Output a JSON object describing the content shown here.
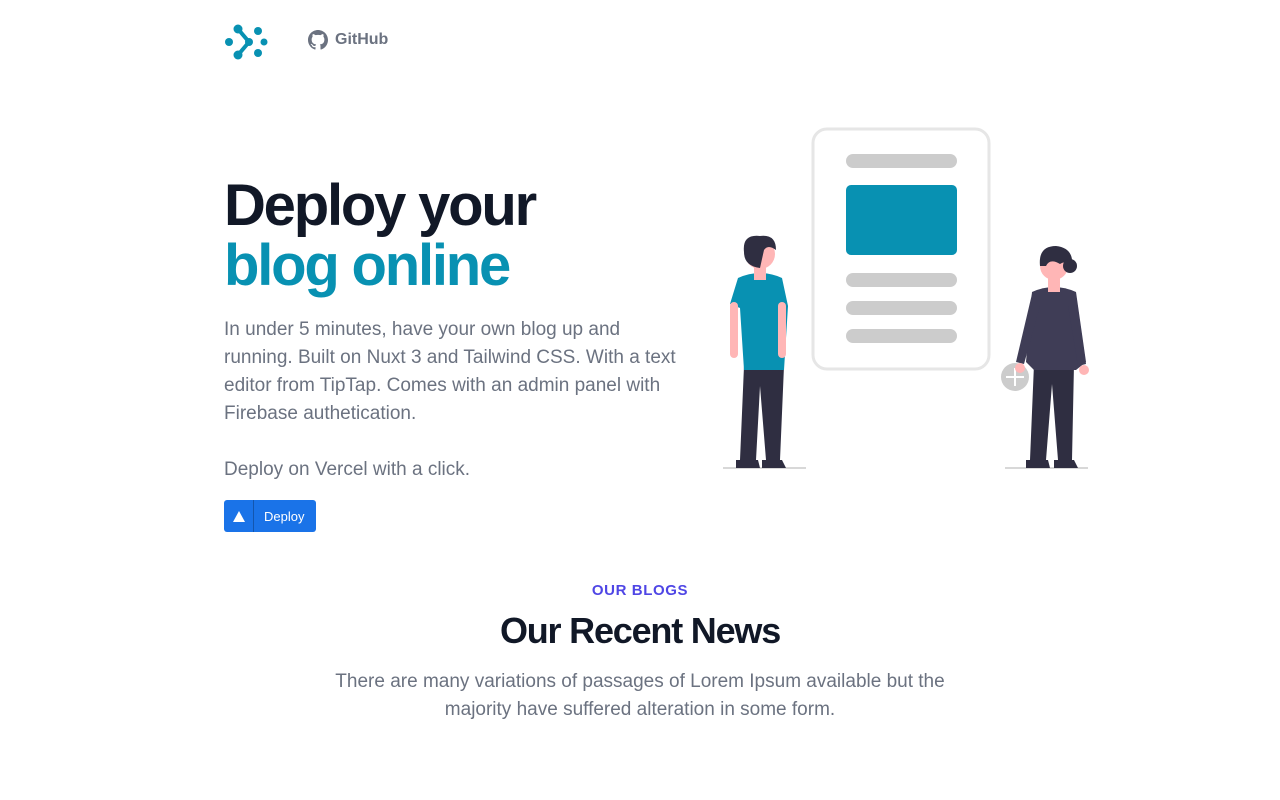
{
  "nav": {
    "logo_icon": "dots-chevron-logo-icon",
    "github_icon": "github-icon",
    "github_label": "GitHub"
  },
  "hero": {
    "title_line1": "Deploy your",
    "title_line2": "blog online",
    "description": "In under 5 minutes, have your own blog up and running. Built on Nuxt 3 and Tailwind CSS. With a text editor from TipTap. Comes with an admin panel with Firebase authetication.",
    "subtext": "Deploy on Vercel with a click.",
    "deploy_label": "Deploy",
    "deploy_icon": "vercel-triangle-icon",
    "illustration": "two-people-with-document-illustration"
  },
  "blogs": {
    "eyebrow": "OUR BLOGS",
    "title": "Our Recent News",
    "description": "There are many variations of passages of Lorem Ipsum available but the majority have suffered alteration in some form."
  },
  "colors": {
    "accent": "#0891b2",
    "eyebrow": "#4f46e5",
    "deploy_button": "#1a73e8",
    "heading": "#111827",
    "body_text": "#6b7280"
  }
}
